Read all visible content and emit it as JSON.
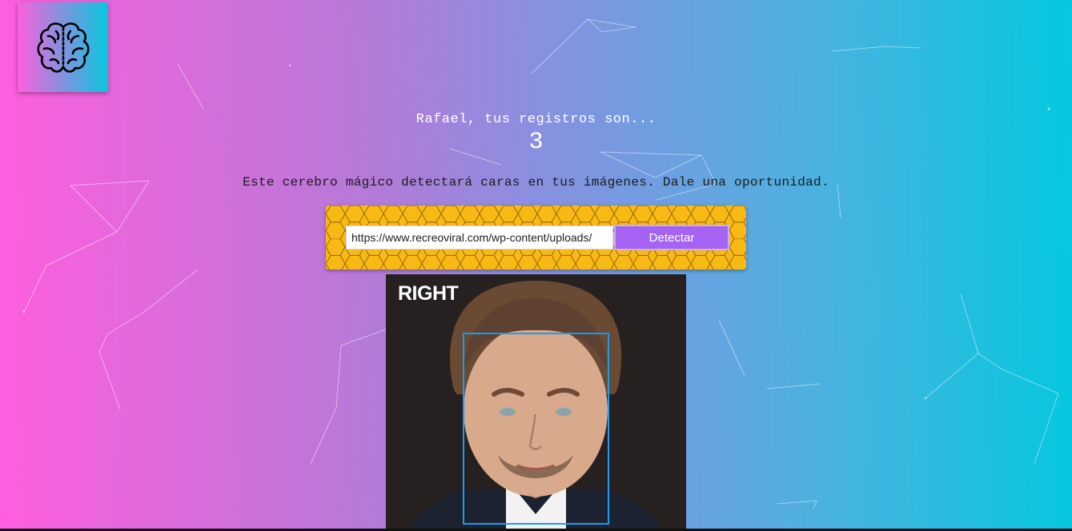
{
  "logo": {
    "icon": "brain-icon"
  },
  "greeting": "Rafael, tus registros son...",
  "entry_count": "3",
  "description": "Este cerebro mágico detectará caras en tus imágenes. Dale una oportunidad.",
  "form": {
    "url_value": "https://www.recreoviral.com/wp-content/uploads/",
    "detect_label": "Detectar"
  },
  "photo": {
    "caption": "RIGHT"
  },
  "colors": {
    "gradient_start": "#ff5edf",
    "gradient_end": "#04c8de",
    "panel": "#f9b914",
    "button": "#a463f2",
    "face_box": "#149df2"
  }
}
